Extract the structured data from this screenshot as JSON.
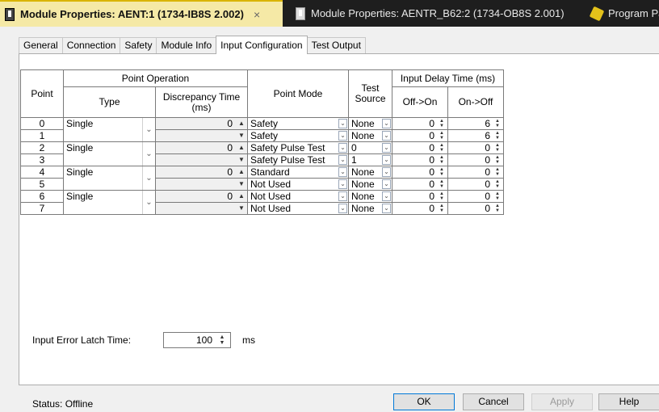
{
  "doc_tabs": [
    {
      "label": "Module Properties: AENT:1 (1734-IB8S 2.002)",
      "close": "×"
    },
    {
      "label": "Module Properties: AENTR_B62:2 (1734-OB8S 2.001)"
    },
    {
      "label": "Program Pa"
    }
  ],
  "tabs": [
    "General",
    "Connection",
    "Safety",
    "Module Info",
    "Input Configuration",
    "Test Output"
  ],
  "table": {
    "headers": {
      "point": "Point",
      "point_operation": "Point Operation",
      "type": "Type",
      "discrepancy": "Discrepancy Time (ms)",
      "point_mode": "Point Mode",
      "test_source": "Test Source",
      "input_delay": "Input Delay Time (ms)",
      "off_on": "Off->On",
      "on_off": "On->Off"
    },
    "pairs": [
      {
        "type": "Single",
        "discrepancy": "0",
        "rows": [
          {
            "point": "0",
            "mode": "Safety",
            "source": "None",
            "off_on": "0",
            "on_off": "6"
          },
          {
            "point": "1",
            "mode": "Safety",
            "source": "None",
            "off_on": "0",
            "on_off": "6"
          }
        ]
      },
      {
        "type": "Single",
        "discrepancy": "0",
        "rows": [
          {
            "point": "2",
            "mode": "Safety Pulse Test",
            "source": "0",
            "off_on": "0",
            "on_off": "0"
          },
          {
            "point": "3",
            "mode": "Safety Pulse Test",
            "source": "1",
            "off_on": "0",
            "on_off": "0"
          }
        ]
      },
      {
        "type": "Single",
        "discrepancy": "0",
        "rows": [
          {
            "point": "4",
            "mode": "Standard",
            "source": "None",
            "off_on": "0",
            "on_off": "0"
          },
          {
            "point": "5",
            "mode": "Not Used",
            "source": "None",
            "off_on": "0",
            "on_off": "0"
          }
        ]
      },
      {
        "type": "Single",
        "discrepancy": "0",
        "rows": [
          {
            "point": "6",
            "mode": "Not Used",
            "source": "None",
            "off_on": "0",
            "on_off": "0"
          },
          {
            "point": "7",
            "mode": "Not Used",
            "source": "None",
            "off_on": "0",
            "on_off": "0"
          }
        ]
      }
    ]
  },
  "latch": {
    "label": "Input Error Latch Time:",
    "value": "100",
    "unit": "ms"
  },
  "status": "Status:  Offline",
  "buttons": {
    "ok": "OK",
    "cancel": "Cancel",
    "apply": "Apply",
    "help": "Help"
  }
}
